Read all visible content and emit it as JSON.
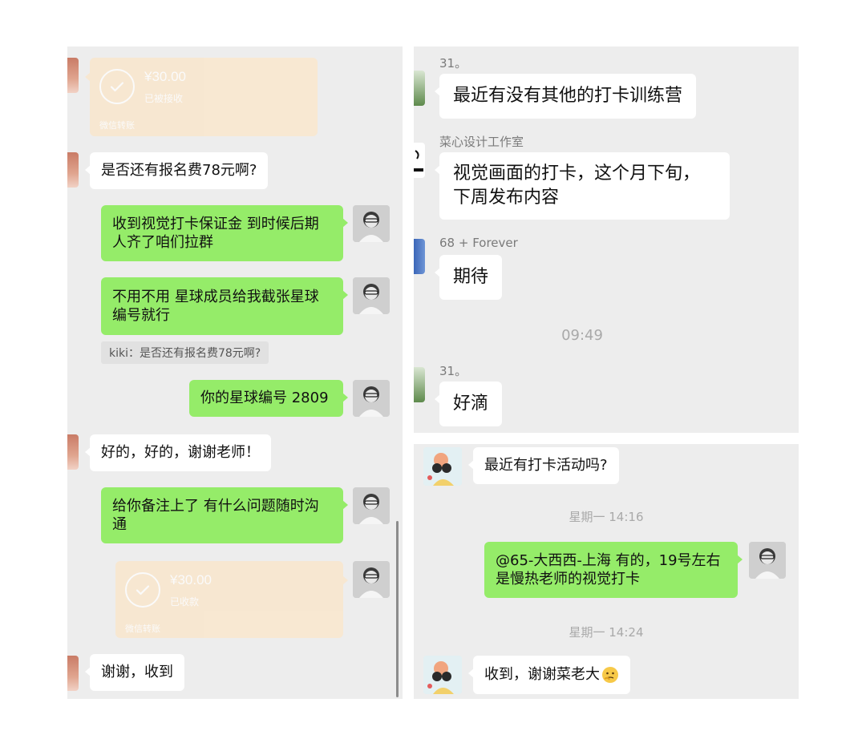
{
  "left_chat": {
    "transfer_top": {
      "amount": "¥30.00",
      "status": "已被接收",
      "footer": "微信转账"
    },
    "msg_fee_question": "是否还有报名费78元啊?",
    "msg_received_deposit": "收到视觉打卡保证金 到时候后期人齐了咱们拉群",
    "msg_no_need": "不用不用 星球成员给我截张星球编号就行",
    "quote": "kiki：是否还有报名费78元啊?",
    "msg_number": "你的星球编号 2809",
    "msg_ok_thanks": "好的，好的，谢谢老师！",
    "msg_noted": "给你备注上了 有什么问题随时沟通",
    "transfer_bottom": {
      "amount": "¥30.00",
      "status": "已收款",
      "footer": "微信转账"
    },
    "msg_got_it": "谢谢，收到"
  },
  "right_top_chat": {
    "sender_1": "31。",
    "msg_other_camps": "最近有没有其他的打卡训练营",
    "sender_2": "菜心设计工作室",
    "msg_visual_checkin": "视觉画面的打卡，这个月下旬，下周发布内容",
    "sender_3": "68 + Forever",
    "msg_looking_forward": "期待",
    "timestamp": "09:49",
    "sender_4": "31。",
    "msg_ok": "好滴"
  },
  "right_bottom_chat": {
    "msg_any_activity": "最近有打卡活动吗?",
    "timestamp_1": "星期一 14:16",
    "msg_reply": "@65-大西西-上海 有的，19号左右是慢热老师的视觉打卡",
    "timestamp_2": "星期一 14:24",
    "msg_thanks_boss": "收到，谢谢菜老大"
  },
  "colors": {
    "chat_background": "#ededed",
    "sent_bubble": "#95ec69",
    "received_bubble": "#ffffff",
    "transfer_card": "#fbe5c8"
  },
  "icons": [
    "check-circle-icon",
    "user-avatar-icon",
    "thinking-face-emoji-icon"
  ]
}
